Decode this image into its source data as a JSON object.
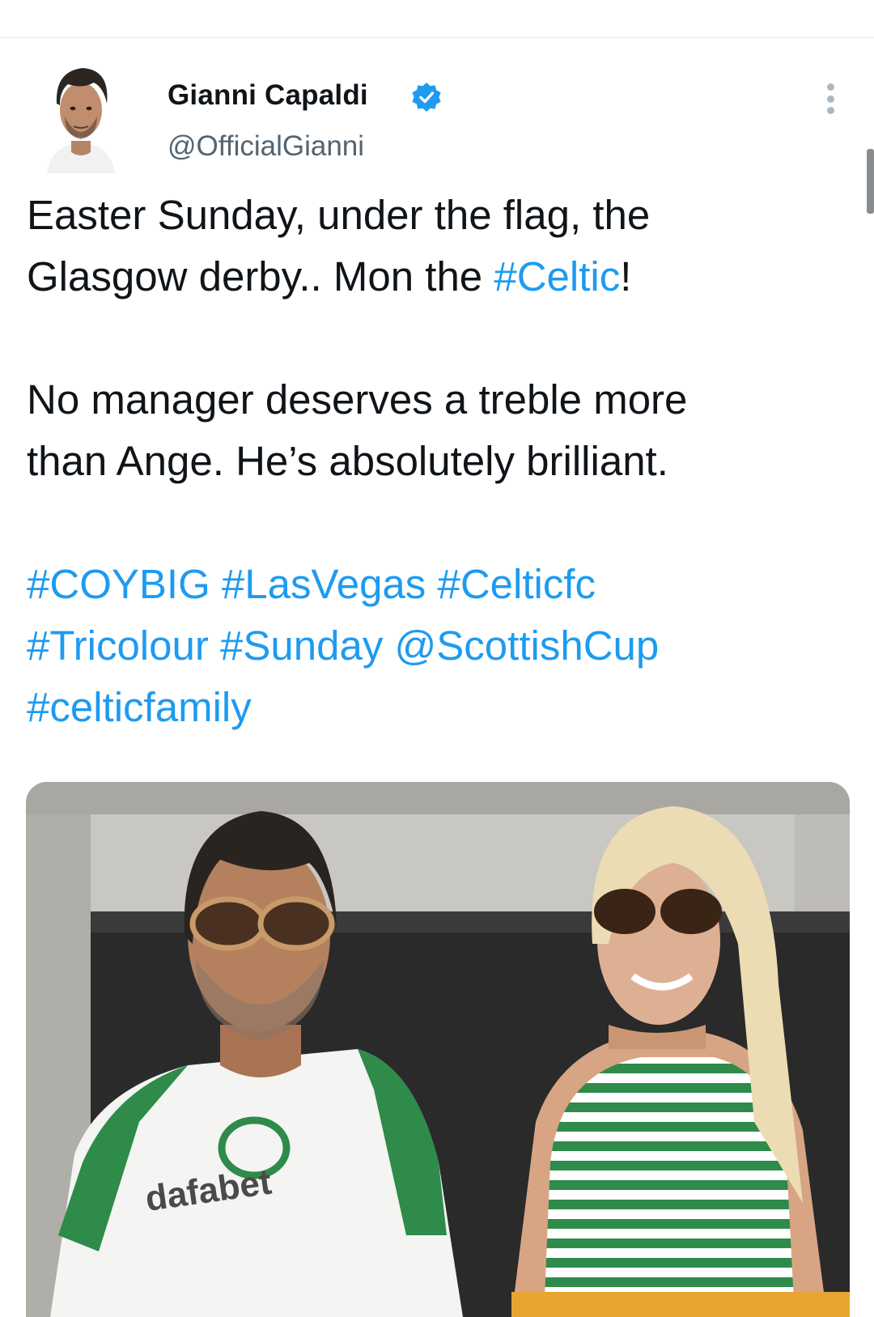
{
  "tweet": {
    "author": {
      "display_name": "Gianni Capaldi",
      "handle": "@OfficialGianni",
      "verified": true
    },
    "text": {
      "line1": "Easter Sunday, under the flag, the",
      "line2_prefix": "Glasgow derby.. Mon the ",
      "line2_link": "#Celtic",
      "line2_suffix": "!",
      "line3": "No manager deserves a treble more",
      "line4": "than Ange. He’s absolutely brilliant.",
      "tags_line1": "#COYBIG #LasVegas #Celticfc",
      "tags_line2": "#Tricolour #Sunday @ScottishCup",
      "tags_line3": "#celticfamily"
    },
    "media": {
      "shirt_sponsor": "dafabet"
    }
  },
  "colors": {
    "link": "#1d9bf0",
    "text": "#0f1419",
    "secondary": "#536471",
    "verified": "#1d9bf0"
  }
}
